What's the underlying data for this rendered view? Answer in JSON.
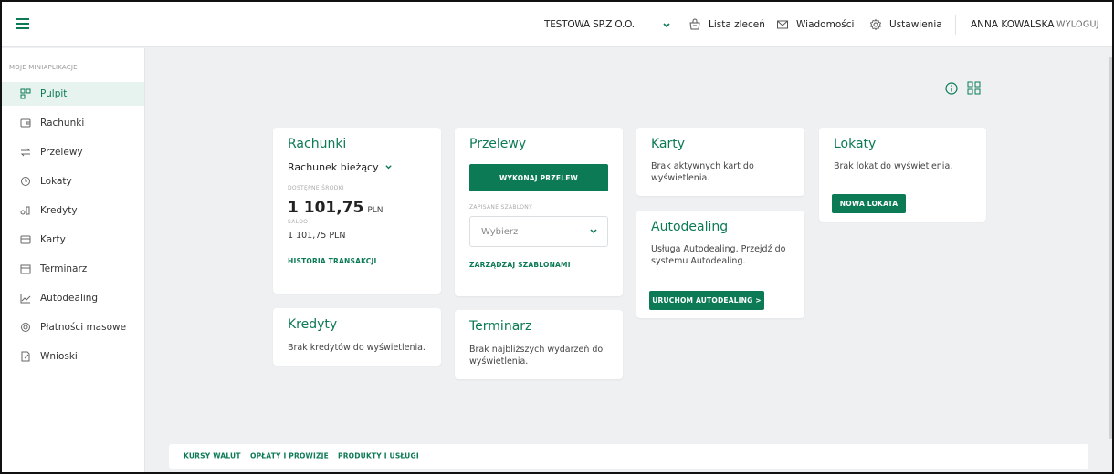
{
  "topbar": {
    "company": "TESTOWA SP.Z O.O.",
    "orders": "Lista zleceń",
    "messages": "Wiadomości",
    "settings": "Ustawienia",
    "user": "ANNA KOWALSKA",
    "logout": "WYLOGUJ"
  },
  "sidebar": {
    "title": "MOJE MINIAPLIKACJE",
    "items": [
      {
        "label": "Pulpit",
        "icon": "dashboard-icon"
      },
      {
        "label": "Rachunki",
        "icon": "wallet-icon"
      },
      {
        "label": "Przelewy",
        "icon": "transfer-icon"
      },
      {
        "label": "Lokaty",
        "icon": "deposit-icon"
      },
      {
        "label": "Kredyty",
        "icon": "credit-icon"
      },
      {
        "label": "Karty",
        "icon": "card-icon"
      },
      {
        "label": "Terminarz",
        "icon": "calendar-icon"
      },
      {
        "label": "Autodealing",
        "icon": "chart-icon"
      },
      {
        "label": "Płatności masowe",
        "icon": "mass-payment-icon"
      },
      {
        "label": "Wnioski",
        "icon": "application-icon"
      }
    ]
  },
  "cards": {
    "accounts": {
      "title": "Rachunki",
      "account_type": "Rachunek bieżący",
      "available_label": "DOSTĘPNE ŚRODKI",
      "available_amount": "1 101,75",
      "available_currency": "PLN",
      "balance_label": "SALDO",
      "balance_value": "1 101,75 PLN",
      "history_link": "HISTORIA TRANSAKCJI"
    },
    "transfers": {
      "title": "Przelewy",
      "execute_button": "WYKONAJ PRZELEW",
      "templates_label": "ZAPISANE SZABLONY",
      "templates_placeholder": "Wybierz",
      "manage_link": "ZARZĄDZAJ SZABLONAMI"
    },
    "cards": {
      "title": "Karty",
      "text": "Brak aktywnych kart do wyświetlenia."
    },
    "deposits": {
      "title": "Lokaty",
      "text": "Brak lokat do wyświetlenia.",
      "button": "NOWA LOKATA"
    },
    "autodealing": {
      "title": "Autodealing",
      "text": "Usługa Autodealing. Przejdź do systemu Autodealing.",
      "button": "URUCHOM AUTODEALING >"
    },
    "credits": {
      "title": "Kredyty",
      "text": "Brak kredytów do wyświetlenia."
    },
    "schedule": {
      "title": "Terminarz",
      "text": "Brak najbliższych wydarzeń do wyświetlenia."
    }
  },
  "footer": {
    "rates": "KURSY WALUT",
    "fees": "OPŁATY I PROWIZJE",
    "products": "PRODUKTY I USŁUGI"
  },
  "colors": {
    "accent": "#0b7a55",
    "background": "#eef0f2",
    "active_item_bg": "#e6f3ef"
  }
}
